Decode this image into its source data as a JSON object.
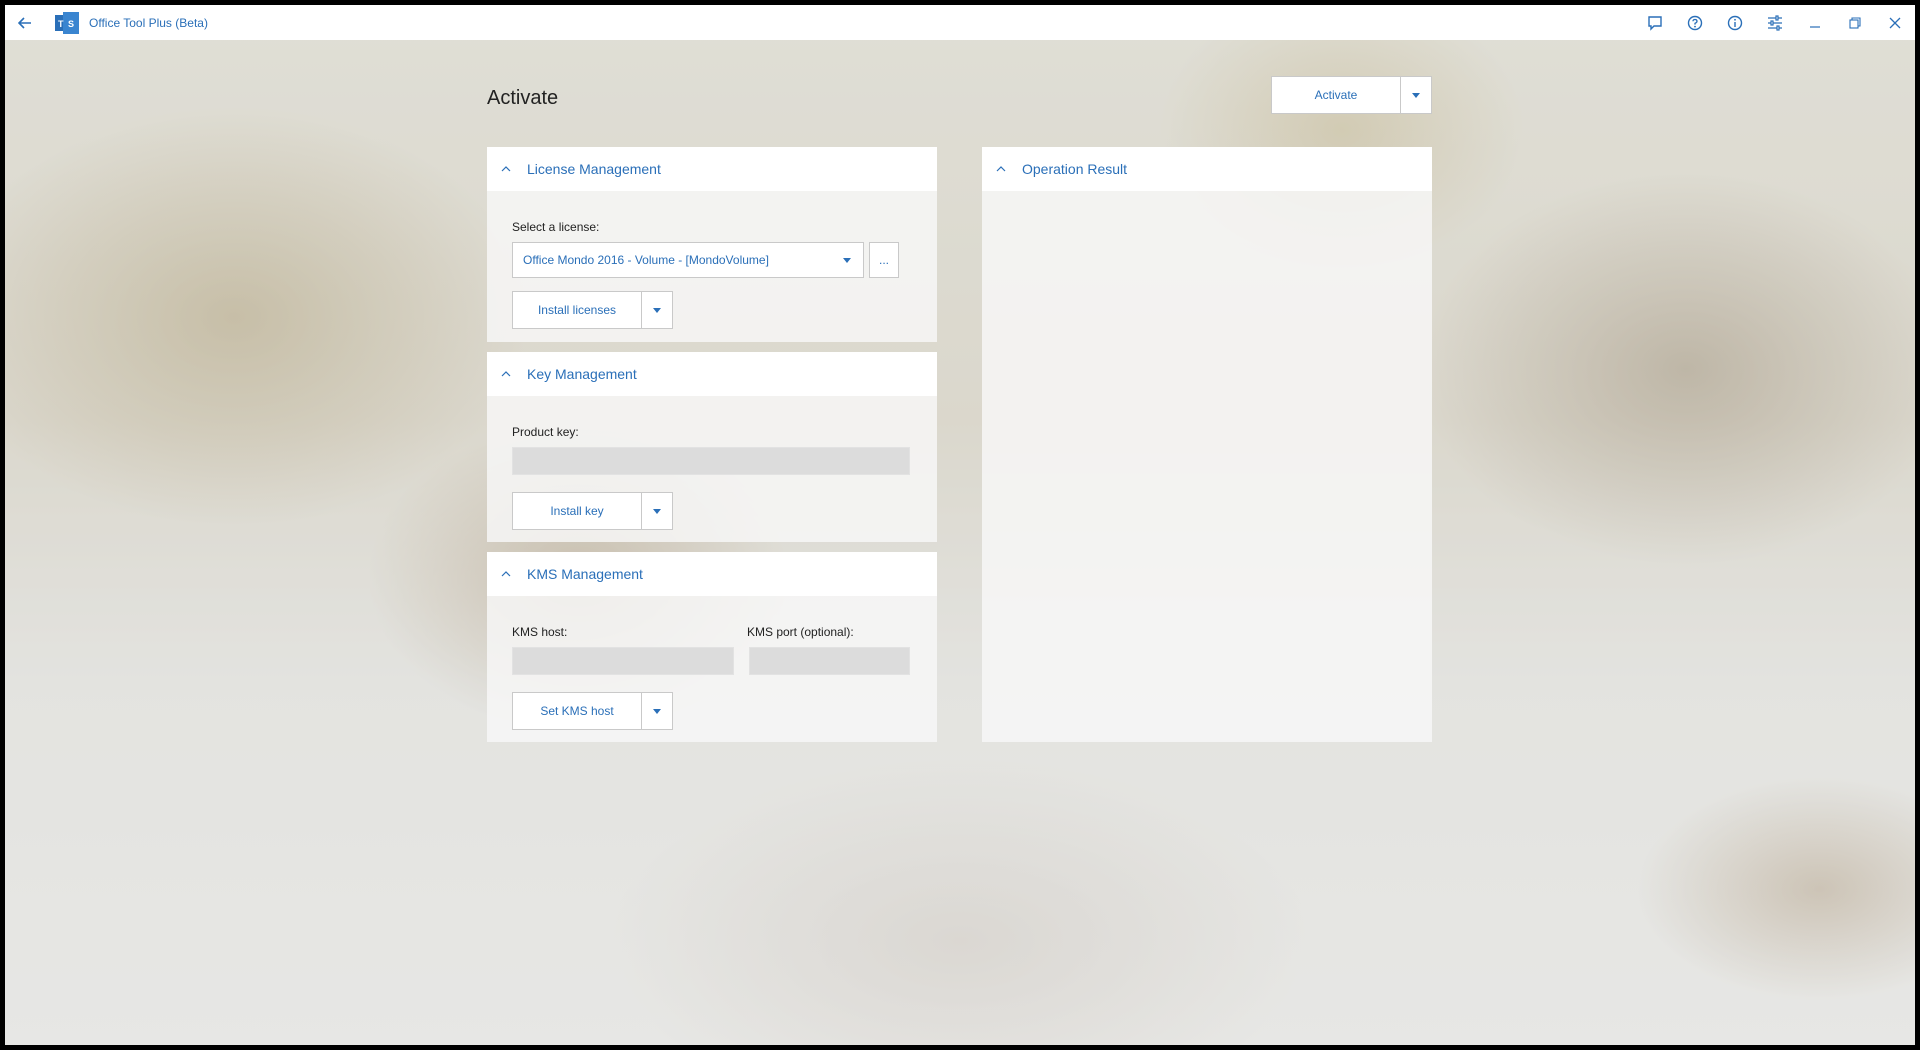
{
  "window": {
    "title": "Office Tool Plus (Beta)"
  },
  "page": {
    "title": "Activate",
    "activate_button": "Activate"
  },
  "license_management": {
    "title": "License Management",
    "select_label": "Select a license:",
    "selected_license": "Office Mondo 2016 - Volume - [MondoVolume]",
    "more_button": "...",
    "install_button": "Install licenses"
  },
  "key_management": {
    "title": "Key Management",
    "product_key_label": "Product key:",
    "product_key_value": "",
    "install_button": "Install key"
  },
  "kms_management": {
    "title": "KMS Management",
    "host_label": "KMS host:",
    "port_label": "KMS port (optional):",
    "host_value": "",
    "port_value": "",
    "set_button": "Set KMS host"
  },
  "operation_result": {
    "title": "Operation Result"
  },
  "icons": {
    "back": "back-arrow-icon",
    "feedback": "feedback-icon",
    "help": "help-icon",
    "info": "info-icon",
    "settings": "settings-sliders-icon",
    "minimize": "minimize-icon",
    "restore": "restore-icon",
    "close": "close-icon"
  },
  "colors": {
    "accent": "#2a6fb8"
  }
}
